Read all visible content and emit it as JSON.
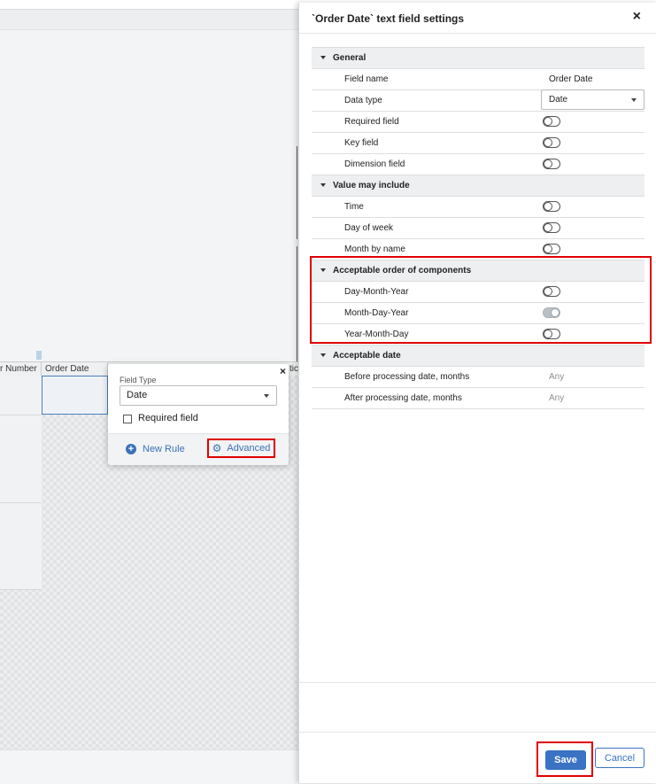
{
  "background": {
    "grid_headers": [
      "r Number",
      "Order Date",
      "tic"
    ]
  },
  "popover": {
    "close_glyph": "×",
    "field_type_label": "Field Type",
    "field_type_value": "Date",
    "required_field_label": "Required field",
    "new_rule_label": "New Rule",
    "advanced_label": "Advanced",
    "plus_icon": "plus-circle-icon",
    "gear_icon": "gear-icon"
  },
  "panel": {
    "title": "`Order Date` text field settings",
    "close_glyph": "×",
    "sections": [
      {
        "title": "General",
        "rows": [
          {
            "label": "Field name",
            "type": "text",
            "value": "Order Date"
          },
          {
            "label": "Data type",
            "type": "select",
            "value": "Date"
          },
          {
            "label": "Required field",
            "type": "toggle",
            "on": false
          },
          {
            "label": "Key field",
            "type": "toggle",
            "on": false
          },
          {
            "label": "Dimension field",
            "type": "toggle",
            "on": false
          }
        ]
      },
      {
        "title": "Value may include",
        "rows": [
          {
            "label": "Time",
            "type": "toggle",
            "on": false
          },
          {
            "label": "Day of week",
            "type": "toggle",
            "on": false
          },
          {
            "label": "Month by name",
            "type": "toggle",
            "on": false
          }
        ]
      },
      {
        "title": "Acceptable order of components",
        "rows": [
          {
            "label": "Day-Month-Year",
            "type": "toggle",
            "on": false
          },
          {
            "label": "Month-Day-Year",
            "type": "toggle",
            "on": true
          },
          {
            "label": "Year-Month-Day",
            "type": "toggle",
            "on": false
          }
        ]
      },
      {
        "title": "Acceptable date",
        "rows": [
          {
            "label": "Before processing date, months",
            "type": "muted",
            "value": "Any"
          },
          {
            "label": "After processing date, months",
            "type": "muted",
            "value": "Any"
          }
        ]
      }
    ],
    "save_label": "Save",
    "cancel_label": "Cancel"
  },
  "colors": {
    "accent": "#3a72c4",
    "highlight": "#e00000"
  }
}
